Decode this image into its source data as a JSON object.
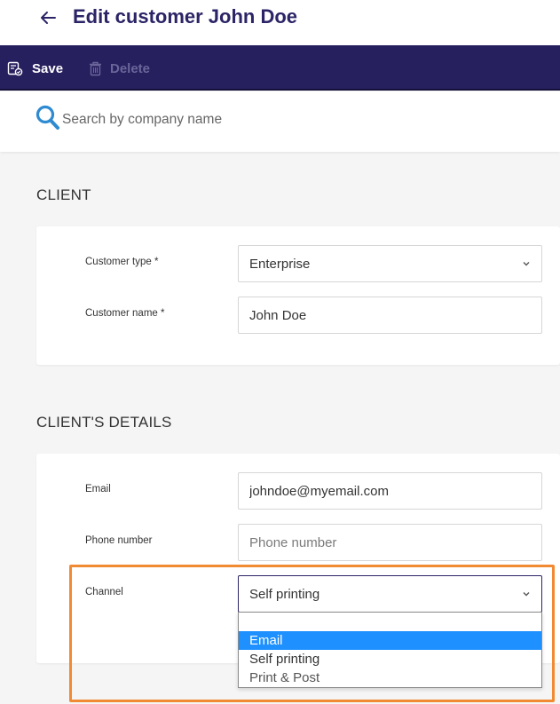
{
  "header": {
    "title": "Edit customer John Doe"
  },
  "toolbar": {
    "save_label": "Save",
    "delete_label": "Delete"
  },
  "search": {
    "placeholder": "Search by company name",
    "value": ""
  },
  "client_section": {
    "title": "CLIENT",
    "customer_type": {
      "label": "Customer type *",
      "value": "Enterprise"
    },
    "customer_name": {
      "label": "Customer name *",
      "value": "John Doe"
    }
  },
  "details_section": {
    "title": "CLIENT'S DETAILS",
    "email": {
      "label": "Email",
      "value": "johndoe@myemail.com"
    },
    "phone": {
      "label": "Phone number",
      "placeholder": "Phone number",
      "value": ""
    },
    "channel": {
      "label": "Channel",
      "value": "Self printing",
      "options": [
        "Email",
        "Self printing",
        "Print & Post"
      ],
      "highlighted_option": "Email"
    }
  },
  "colors": {
    "brand": "#27205f",
    "title": "#2b2466",
    "highlight_border": "#f08a33",
    "option_highlight": "#1e90ff"
  }
}
